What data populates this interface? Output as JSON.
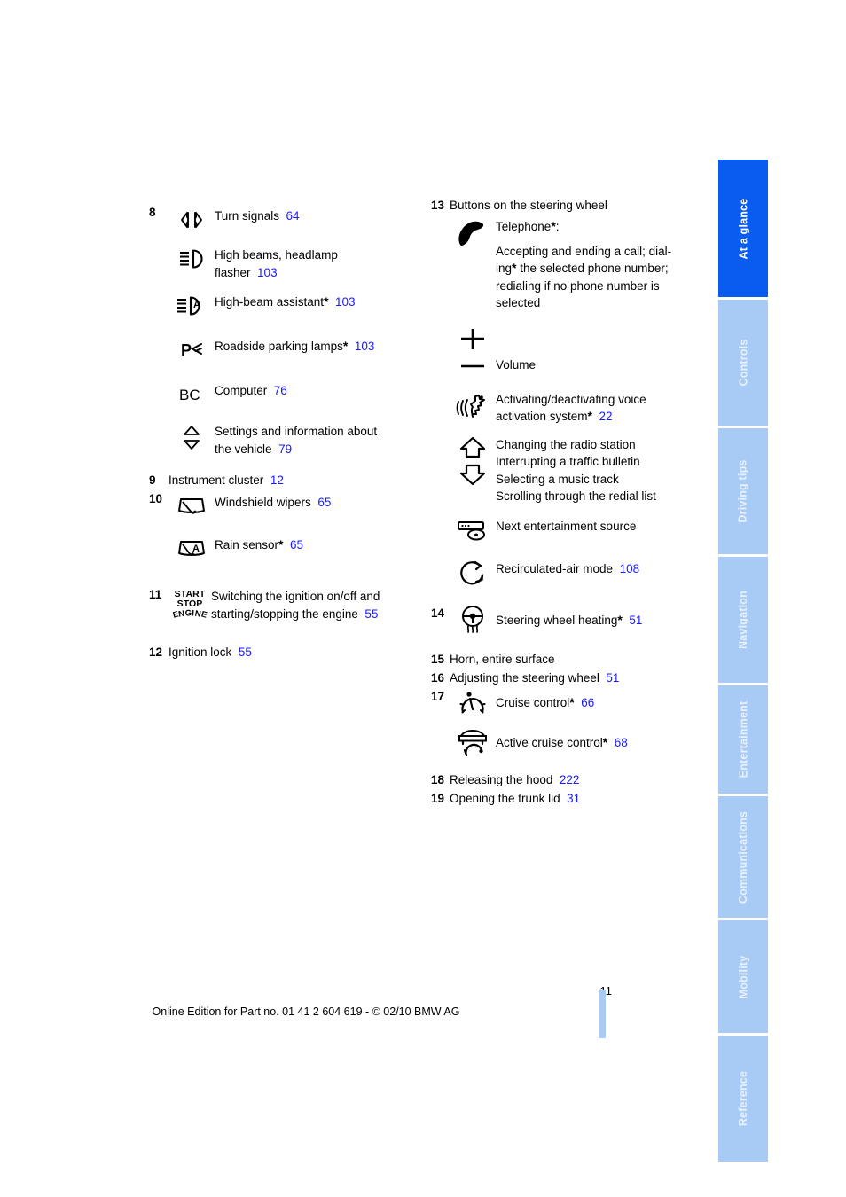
{
  "page": {
    "number": "11",
    "footer_text": "Online Edition for Part no. 01 41 2 604 619 - © 02/10 BMW AG"
  },
  "colors": {
    "reference_blue": "#1a1aff",
    "tab_active_blue": "#0a5bf0",
    "tab_idle_blue": "#a8cbf5",
    "tab_idle_text": "#e8f1fd"
  },
  "sidebar": {
    "tabs": [
      {
        "label": "At a glance",
        "active": true
      },
      {
        "label": "Controls",
        "active": false
      },
      {
        "label": "Driving tips",
        "active": false
      },
      {
        "label": "Navigation",
        "active": false
      },
      {
        "label": "Entertainment",
        "active": false
      },
      {
        "label": "Communications",
        "active": false
      },
      {
        "label": "Mobility",
        "active": false
      },
      {
        "label": "Reference",
        "active": false
      }
    ]
  },
  "left_column": {
    "item8": {
      "number": "8",
      "entries": [
        {
          "icon": "turn-signals-icon",
          "label": "Turn signals",
          "ref": "64"
        },
        {
          "icon": "high-beams-icon",
          "label_line1": "High beams, headlamp",
          "label_line2": "flasher",
          "ref": "103"
        },
        {
          "icon": "high-beam-assistant-icon",
          "label": "High-beam assistant",
          "star": "*",
          "ref": "103"
        },
        {
          "icon": "roadside-parking-lamps-icon",
          "label": "Roadside parking lamps",
          "star": "*",
          "ref": "103"
        },
        {
          "icon": "bc-computer-icon",
          "label": "Computer",
          "ref": "76"
        },
        {
          "icon": "up-down-triangles-icon",
          "label_line1": "Settings and information about",
          "label_line2": "the vehicle",
          "ref": "79"
        }
      ]
    },
    "item9": {
      "number": "9",
      "label": "Instrument cluster",
      "ref": "12"
    },
    "item10": {
      "number": "10",
      "entries": [
        {
          "icon": "windshield-wipers-icon",
          "label": "Windshield wipers",
          "ref": "65"
        },
        {
          "icon": "rain-sensor-icon",
          "label": "Rain sensor",
          "star": "*",
          "ref": "65"
        }
      ]
    },
    "item11": {
      "number": "11",
      "icon": "start-stop-engine-icon",
      "icon_text": {
        "line1": "START",
        "line2": "STOP",
        "line3": "ENGINE"
      },
      "label_line1": "Switching the ignition on/off and",
      "label_line2": "starting/stopping the engine",
      "ref": "55"
    },
    "item12": {
      "number": "12",
      "label": "Ignition lock",
      "ref": "55"
    }
  },
  "right_column": {
    "item13": {
      "number": "13",
      "label": "Buttons on the steering wheel",
      "entries": [
        {
          "icon": "telephone-handset-icon",
          "title": "Telephone",
          "star": "*",
          "title_suffix": ":",
          "desc_line1": "Accepting and ending a call; dial-",
          "desc_line2_a": "ing",
          "desc_line2_star": "*",
          "desc_line2_b": " the selected phone number;",
          "desc_line3": "redialing if no phone number is",
          "desc_line4": "selected"
        },
        {
          "icon": "plus-minus-volume-icon",
          "label": "Volume"
        },
        {
          "icon": "voice-activation-icon",
          "label_line1": "Activating/deactivating voice",
          "label_line2": "activation system",
          "star": "*",
          "ref": "22"
        },
        {
          "icon": "up-down-arrows-icon",
          "lines": [
            "Changing the radio station",
            "Interrupting a traffic bulletin",
            "Selecting a music track",
            "Scrolling through the redial list"
          ]
        },
        {
          "icon": "entertainment-source-icon",
          "label": "Next entertainment source"
        },
        {
          "icon": "recirculated-air-icon",
          "label": "Recirculated-air mode",
          "ref": "108"
        }
      ]
    },
    "item14": {
      "number": "14",
      "icon": "steering-wheel-heating-icon",
      "label": "Steering wheel heating",
      "star": "*",
      "ref": "51"
    },
    "item15": {
      "number": "15",
      "label": "Horn, entire surface"
    },
    "item16": {
      "number": "16",
      "label": "Adjusting the steering wheel",
      "ref": "51"
    },
    "item17": {
      "number": "17",
      "entries": [
        {
          "icon": "cruise-control-icon",
          "label": "Cruise control",
          "star": "*",
          "ref": "66"
        },
        {
          "icon": "active-cruise-control-icon",
          "label": "Active cruise control",
          "star": "*",
          "ref": "68"
        }
      ]
    },
    "item18": {
      "number": "18",
      "label": "Releasing the hood",
      "ref": "222"
    },
    "item19": {
      "number": "19",
      "label": "Opening the trunk lid",
      "ref": "31"
    }
  }
}
